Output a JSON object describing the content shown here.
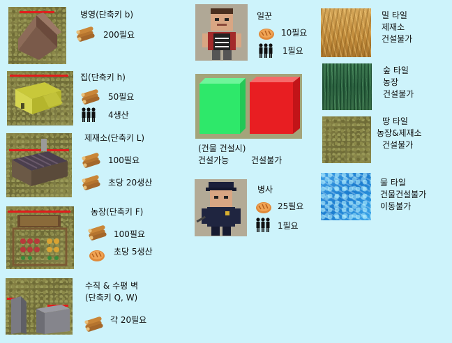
{
  "buildings": [
    {
      "name": "병영(단축키 b)",
      "cost": "200필요"
    },
    {
      "name": "집(단축키 h)",
      "cost": "50필요",
      "produce": "4생산"
    },
    {
      "name": "제재소(단축키 L)",
      "cost": "100필요",
      "produce": "초당 20생산"
    },
    {
      "name": "농장(단축키 F)",
      "cost": "100필요",
      "produce": "초당 5생산"
    },
    {
      "name_line1": "수직 & 수평 벽",
      "name_line2": "(단축키 Q, W)",
      "cost": "각 20필요"
    }
  ],
  "units": {
    "worker": {
      "name": "일꾼",
      "food": "10필요",
      "pop": "1필요"
    },
    "soldier": {
      "name": "병사",
      "food": "25필요",
      "pop": "1필요"
    }
  },
  "build_state": {
    "title": "(건물 건설시)",
    "can": "건설가능",
    "cannot": "건설불가",
    "can_color": "#2ee86a",
    "cannot_color": "#e81e22"
  },
  "tiles": [
    {
      "lines": [
        "밀 타일",
        "제재소",
        "건설불가"
      ]
    },
    {
      "lines": [
        "숲 타일",
        "농장",
        "건설불가"
      ]
    },
    {
      "lines": [
        "땅 타일",
        "농장&제재소",
        "건설불가"
      ]
    },
    {
      "lines": [
        "물 타일",
        "건물건설불가",
        "이동불가"
      ]
    }
  ],
  "icons": {
    "wood": "wood-log-icon",
    "food": "bread-icon",
    "pop": "population-icon"
  }
}
